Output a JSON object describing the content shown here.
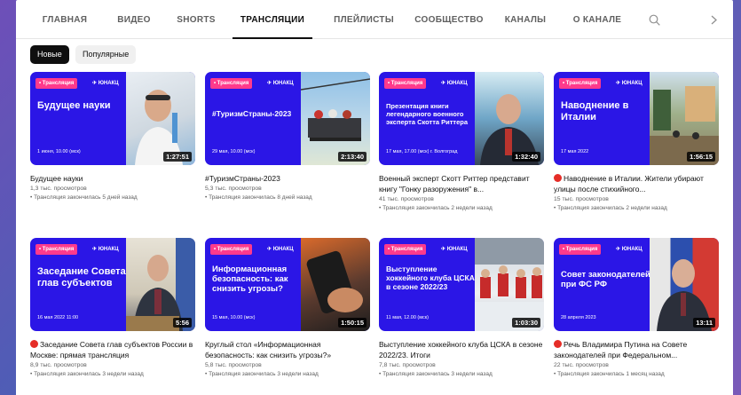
{
  "tabs": [
    "ГЛАВНАЯ",
    "ВИДЕО",
    "SHORTS",
    "ТРАНСЛЯЦИИ",
    "ПЛЕЙЛИСТЫ",
    "СООБЩЕСТВО",
    "КАНАЛЫ",
    "О КАНАЛЕ"
  ],
  "active_tab": "ТРАНСЛЯЦИИ",
  "chips": [
    "Новые",
    "Популярные"
  ],
  "thumb_tag": "• Трансляция",
  "thumb_logo": "✈ ЮНАКЦ",
  "colors": {
    "thumb_bg": "#2b16e6",
    "tag": "#ff3a8c",
    "live_dot": "#e52d27"
  },
  "videos": [
    {
      "headline": "Будущее науки",
      "dateline": "1 июня, 10.00 (мск)",
      "duration": "1:27:51",
      "title": "Будущее науки",
      "views": "1,3 тыс. просмотров",
      "status": "• Трансляция закончилась 5 дней назад"
    },
    {
      "headline": "#ТуризмСтраны-2023",
      "dateline": "29 мая, 10.00 (мск)",
      "duration": "2:13:40",
      "title": "#ТуризмСтраны-2023",
      "views": "5,3 тыс. просмотров",
      "status": "• Трансляция закончилась 8 дней назад"
    },
    {
      "headline": "Презентация книги легендарного военного эксперта Скотта Риттера",
      "dateline": "17 мая, 17.00 (мск) г. Волгоград",
      "duration": "1:32:40",
      "title": "Военный эксперт Скотт Риттер представит книгу \"Гонку разоружения\" в...",
      "views": "41 тыс. просмотров",
      "status": "• Трансляция закончилась 2 недели назад"
    },
    {
      "headline": "Наводнение в Италии",
      "dateline": "17 мая 2022",
      "duration": "1:56:15",
      "title": "Наводнение в Италии. Жители убирают улицы после стихийного...",
      "views": "15 тыс. просмотров",
      "status": "• Трансляция закончилась 2 недели назад"
    },
    {
      "headline": "Заседание Совета глав субъектов",
      "dateline": "16 мая 2022 11:00",
      "duration": "5:56",
      "title": "Заседание Совета глав субъектов России в Москве: прямая трансляция",
      "views": "8,9 тыс. просмотров",
      "status": "• Трансляция закончилась 3 недели назад"
    },
    {
      "headline": "Информационная безопасность: как снизить угрозы?",
      "dateline": "15 мая, 10.00 (мск)",
      "duration": "1:50:15",
      "title": "Круглый стол «Информационная безопасность: как снизить угрозы?»",
      "views": "5,8 тыс. просмотров",
      "status": "• Трансляция закончилась 3 недели назад"
    },
    {
      "headline": "Выступление хоккейного клуба ЦСКА в сезоне 2022/23",
      "dateline": "11 мая, 12.00 (мск)",
      "duration": "1:03:30",
      "title": "Выступление хоккейного клуба ЦСКА в сезоне 2022/23. Итоги",
      "views": "7,8 тыс. просмотров",
      "status": "• Трансляция закончилась 3 недели назад"
    },
    {
      "headline": "Совет законодателей при ФС РФ",
      "dateline": "28 апреля 2023",
      "duration": "13:11",
      "title": "Речь Владимира Путина на Совете законодателей при Федеральном...",
      "views": "22 тыс. просмотров",
      "status": "• Трансляция закончилась 1 месяц назад"
    }
  ]
}
